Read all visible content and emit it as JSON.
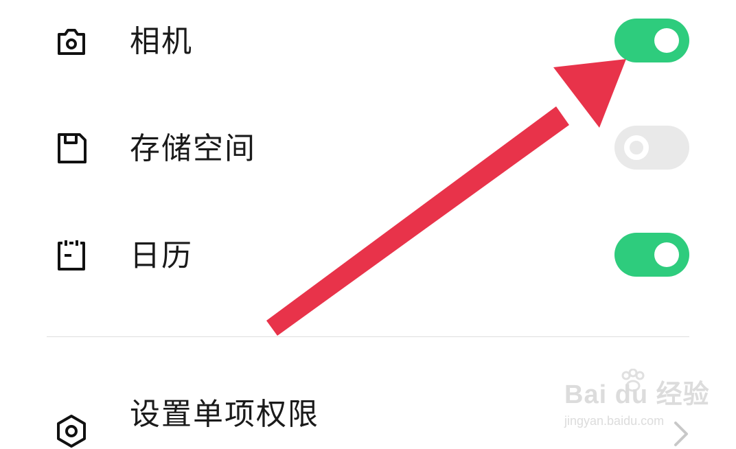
{
  "permissions": [
    {
      "label": "相机",
      "icon": "camera-icon",
      "enabled": true
    },
    {
      "label": "存储空间",
      "icon": "storage-icon",
      "enabled": false
    },
    {
      "label": "日历",
      "icon": "calendar-icon",
      "enabled": true
    }
  ],
  "settings_item": {
    "label": "设置单项权限",
    "icon": "settings-hexagon-icon"
  },
  "watermark": {
    "logo": "Bai du 经验",
    "url": "jingyan.baidu.com"
  },
  "colors": {
    "toggle_on": "#2ecc7d",
    "toggle_off": "#e9e9e9",
    "annotation_arrow": "#e8334a"
  }
}
